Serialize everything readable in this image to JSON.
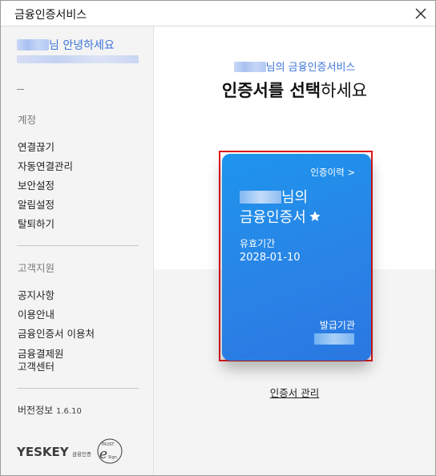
{
  "window": {
    "title": "금융인증서비스"
  },
  "sidebar": {
    "greeting_suffix": "님 안녕하세요",
    "sections": [
      {
        "title": "계정",
        "items": [
          "연결끊기",
          "자동연결관리",
          "보안설정",
          "알림설정",
          "탈퇴하기"
        ]
      },
      {
        "title": "고객지원",
        "items": [
          "공지사항",
          "이용안내",
          "금융인증서 이용처",
          "금융결제원",
          "고객센터"
        ]
      }
    ],
    "version_label": "버전정보",
    "version_number": "1.6.10",
    "logo": {
      "brand": "YESKEY",
      "sub": "금융인증",
      "badge_top": "TRUST",
      "badge_bottom": "Sign"
    }
  },
  "main": {
    "service_suffix": "님의 금융인증서비스",
    "heading_bold": "인증서를 선택",
    "heading_rest": "하세요",
    "card": {
      "history_link": "인증이력 >",
      "owner_suffix": "님의",
      "cert_name": "금융인증서",
      "valid_label": "유효기간",
      "valid_date": "2028-01-10",
      "issuer_label": "발급기관"
    },
    "manage_link": "인증서 관리"
  },
  "colors": {
    "accent": "#3d74d9",
    "card": "#2a82e6",
    "highlight": "#e0191d"
  }
}
